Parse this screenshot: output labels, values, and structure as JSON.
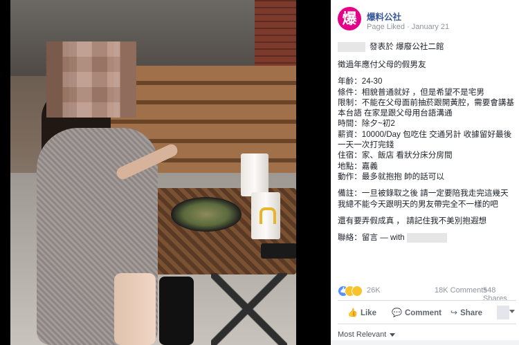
{
  "page": {
    "logo_glyph": "爆",
    "name": "爆料公社",
    "status": "Page Liked",
    "date": "January 21",
    "brand_color": "#e5008a",
    "link_color": "#365899"
  },
  "post": {
    "posted_in": "發表於 爆廢公社二館",
    "lines": [
      "徵過年應付父母的假男友",
      "",
      "年齡：24-30",
      "條件：相貌普通就好 ，但是希望不是宅男",
      "限制：不能在父母面前抽菸跟開黃腔，需要會講基本台語 在家是跟父母用台語溝通",
      "時間：除夕~初2",
      "薪資：10000/Day 包吃住 交通另計 收據留好最後一天一次打完錢",
      "住宿：家、飯店 看狀分床分房間",
      "地點：嘉義",
      "動作：最多就抱抱 帥的話可以",
      "",
      "備註：一旦被錄取之後 請一定要陪我走完這幾天 我總不能今天跟明天的男友帶完全不一樣的吧",
      "",
      "還有要弄假成真 ， 請記住我不美別抱遐想",
      "",
      "聯絡：留言 — with"
    ]
  },
  "stats": {
    "reactions": "26K",
    "comments": "18K Comments",
    "shares": "548 Shares"
  },
  "actions": {
    "like": "Like",
    "comment": "Comment",
    "share": "Share"
  },
  "sort": {
    "label": "Most Relevant"
  }
}
